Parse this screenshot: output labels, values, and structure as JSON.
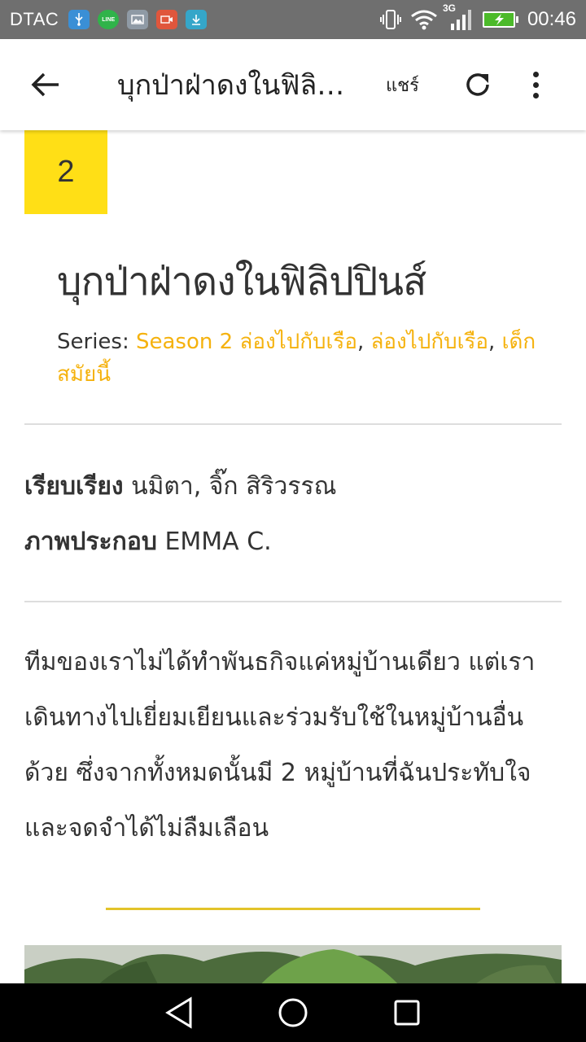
{
  "status_bar": {
    "carrier": "DTAC",
    "network": "3G",
    "time": "00:46",
    "icons": [
      "usb-icon",
      "line-icon",
      "gallery-icon",
      "recorder-icon",
      "download-icon",
      "vibrate-icon",
      "wifi-icon",
      "signal-icon",
      "battery-charging-icon"
    ],
    "line_label": "LINE"
  },
  "app_bar": {
    "title": "บุกป่าฝ่าดงในฟิลิปปินส์",
    "share_label": "แชร์"
  },
  "article": {
    "episode": "2",
    "title": "บุกป่าฝ่าดงในฟิลิปปินส์",
    "series_label": "Series:",
    "series_links": [
      "Season 2 ล่องไปกับเรือ",
      "ล่องไปกับเรือ",
      "เด็กสมัยนี้"
    ],
    "credits": [
      {
        "label": "เรียบเรียง",
        "value": "นมิตา, จิ๊ก สิริวรรณ"
      },
      {
        "label": "ภาพประกอบ",
        "value": "EMMA C."
      }
    ],
    "body": "ทีมของเราไม่ได้ทำพันธกิจแค่หมู่บ้านเดียว แต่เราเดินทางไปเยี่ยมเยียนและร่วมรับใช้ในหมู่บ้านอื่นด้วย ซึ่งจากทั้งหมดนั้นมี 2 หมู่บ้านที่ฉันประทับใจและจดจำได้ไม่ลืมเลือน"
  },
  "colors": {
    "badge": "#ffdf16",
    "link": "#f5b20e",
    "rule": "#e3c32a"
  }
}
